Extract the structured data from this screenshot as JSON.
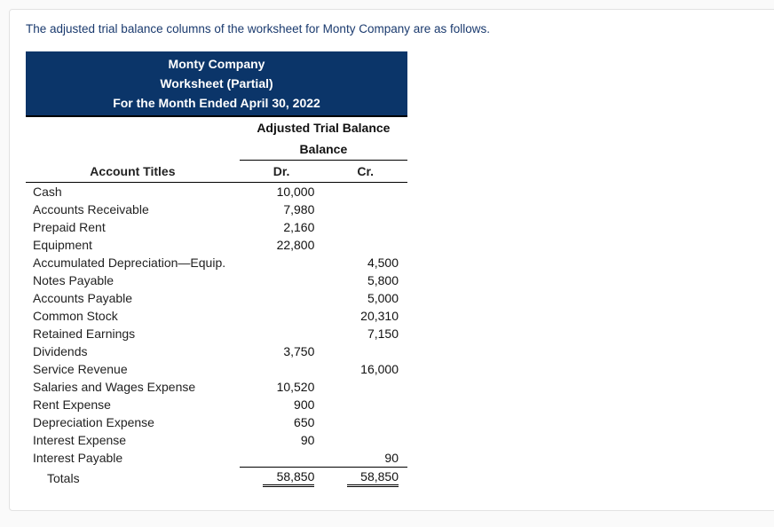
{
  "intro": "The adjusted trial balance columns of the worksheet for Monty Company are as follows.",
  "header": {
    "company": "Monty Company",
    "title": "Worksheet (Partial)",
    "period": "For the Month Ended April 30, 2022"
  },
  "columns": {
    "section": "Adjusted Trial Balance",
    "balance_label": "Balance",
    "account_titles": "Account Titles",
    "dr": "Dr.",
    "cr": "Cr."
  },
  "rows": [
    {
      "label": "Cash",
      "dr": "10,000",
      "cr": ""
    },
    {
      "label": "Accounts Receivable",
      "dr": "7,980",
      "cr": ""
    },
    {
      "label": "Prepaid Rent",
      "dr": "2,160",
      "cr": ""
    },
    {
      "label": "Equipment",
      "dr": "22,800",
      "cr": ""
    },
    {
      "label": "Accumulated Depreciation—Equip.",
      "dr": "",
      "cr": "4,500"
    },
    {
      "label": "Notes Payable",
      "dr": "",
      "cr": "5,800"
    },
    {
      "label": "Accounts Payable",
      "dr": "",
      "cr": "5,000"
    },
    {
      "label": "Common Stock",
      "dr": "",
      "cr": "20,310"
    },
    {
      "label": "Retained Earnings",
      "dr": "",
      "cr": "7,150"
    },
    {
      "label": "Dividends",
      "dr": "3,750",
      "cr": ""
    },
    {
      "label": "Service Revenue",
      "dr": "",
      "cr": "16,000"
    },
    {
      "label": "Salaries and Wages Expense",
      "dr": "10,520",
      "cr": ""
    },
    {
      "label": "Rent Expense",
      "dr": "900",
      "cr": ""
    },
    {
      "label": "Depreciation Expense",
      "dr": "650",
      "cr": ""
    },
    {
      "label": "Interest Expense",
      "dr": "90",
      "cr": ""
    },
    {
      "label": "Interest Payable",
      "dr": "",
      "cr": "90"
    }
  ],
  "totals": {
    "label": "Totals",
    "dr": "58,850",
    "cr": "58,850"
  }
}
